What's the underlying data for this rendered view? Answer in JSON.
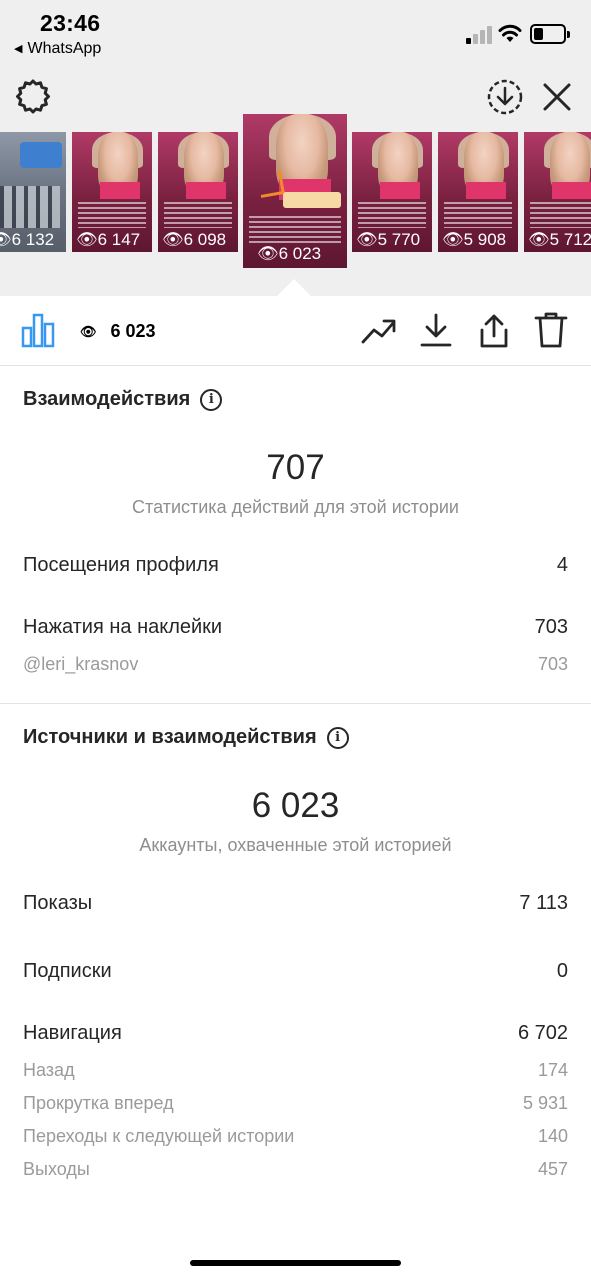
{
  "status_bar": {
    "time": "23:46",
    "back_app": "WhatsApp"
  },
  "stories": [
    {
      "views": "6 132",
      "kind": "room"
    },
    {
      "views": "6 147",
      "kind": "selfie"
    },
    {
      "views": "6 098",
      "kind": "selfie"
    },
    {
      "views": "6 023",
      "kind": "selfie",
      "active": true,
      "handle": "@LERI_KRASNOV"
    },
    {
      "views": "5 770",
      "kind": "selfie"
    },
    {
      "views": "5 908",
      "kind": "selfie"
    },
    {
      "views": "5 712",
      "kind": "selfie"
    }
  ],
  "toolbar": {
    "views": "6 023"
  },
  "interactions": {
    "title": "Взаимодействия",
    "total": "707",
    "subtitle": "Статистика действий для этой истории",
    "profile_visits_label": "Посещения профиля",
    "profile_visits_value": "4",
    "sticker_taps_label": "Нажатия на наклейки",
    "sticker_taps_value": "703",
    "mention_label": "@leri_krasnov",
    "mention_value": "703"
  },
  "discovery": {
    "title": "Источники и взаимодействия",
    "reach": "6 023",
    "subtitle": "Аккаунты, охваченные этой историей",
    "impressions_label": "Показы",
    "impressions_value": "7 113",
    "follows_label": "Подписки",
    "follows_value": "0",
    "navigation_label": "Навигация",
    "navigation_value": "6 702",
    "back_label": "Назад",
    "back_value": "174",
    "forward_label": "Прокрутка вперед",
    "forward_value": "5 931",
    "next_story_label": "Переходы к следующей истории",
    "next_story_value": "140",
    "exits_label": "Выходы",
    "exits_value": "457"
  },
  "colors": {
    "accent": "#3897f0",
    "text": "#262626",
    "muted": "#8e8e8e",
    "story_bg": "#8c2a50"
  }
}
